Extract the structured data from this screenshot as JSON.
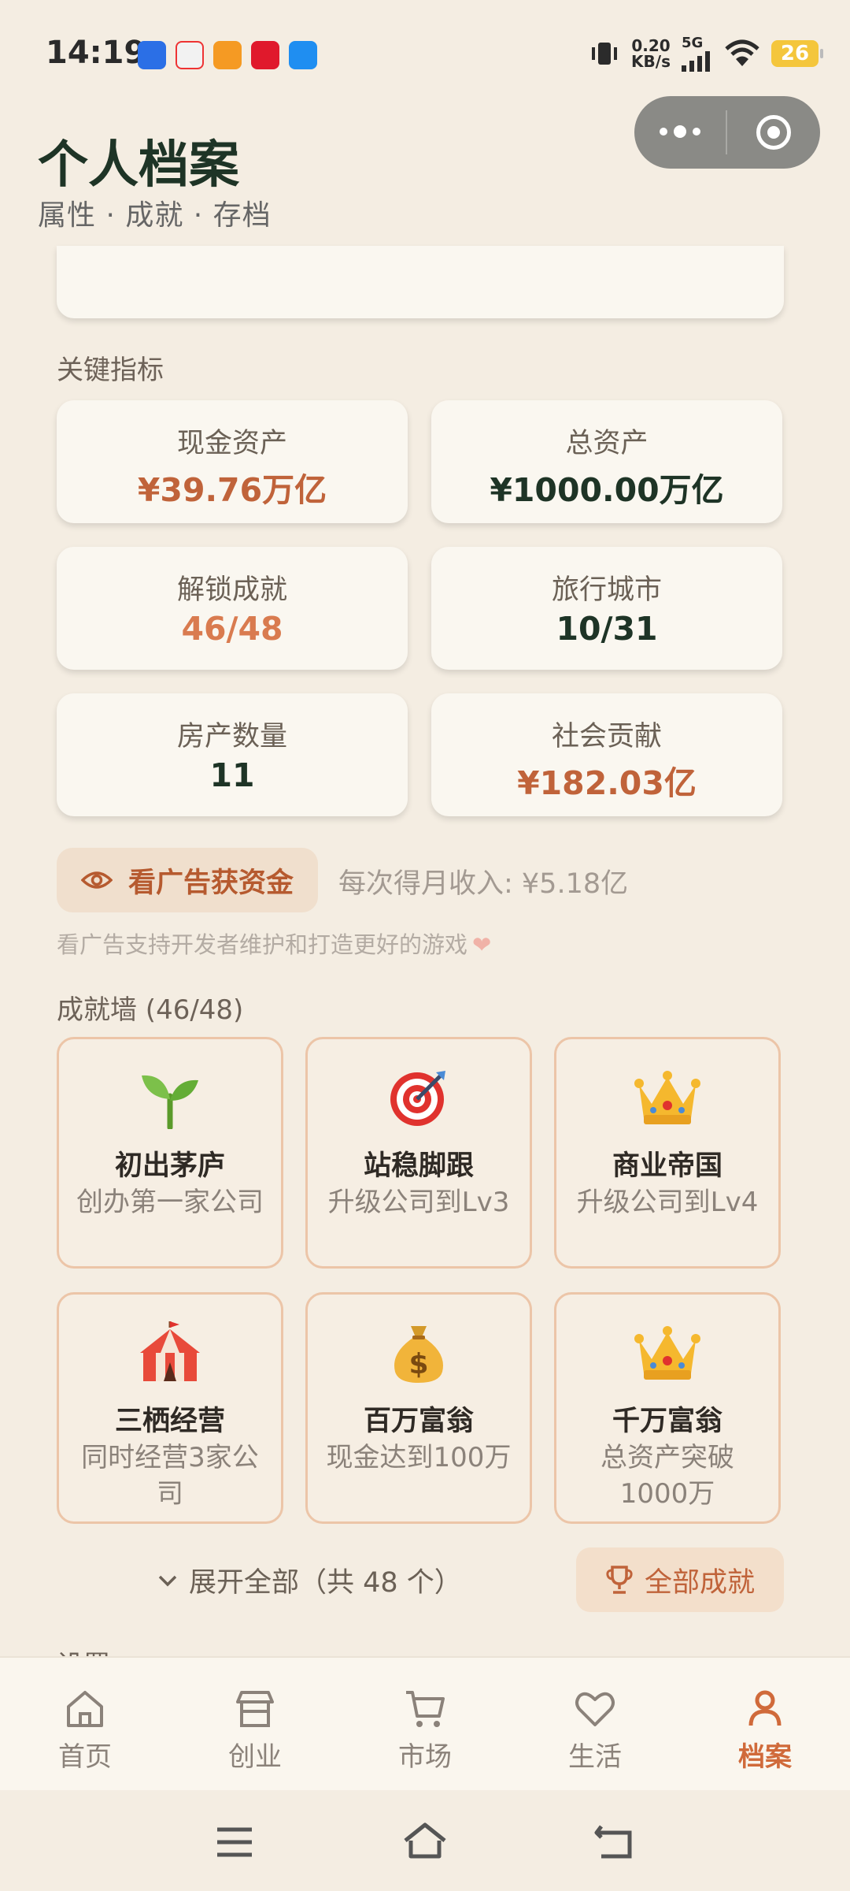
{
  "status_bar": {
    "time": "14:19",
    "speed_value": "0.20",
    "speed_unit": "KB/s",
    "network": "5G",
    "battery": "26"
  },
  "header": {
    "title": "个人档案",
    "subtitle": "属性 · 成就 · 存档"
  },
  "metrics": {
    "section_label": "关键指标",
    "items": [
      {
        "label": "现金资产",
        "value": "¥39.76万亿",
        "color": "#c0633a"
      },
      {
        "label": "总资产",
        "value": "¥1000.00万亿",
        "color": "#1e3426"
      },
      {
        "label": "解锁成就",
        "value": "46/48",
        "color": "#d97b4f"
      },
      {
        "label": "旅行城市",
        "value": "10/31",
        "color": "#1e3426"
      },
      {
        "label": "房产数量",
        "value": "11",
        "color": "#1e3426"
      },
      {
        "label": "社会贡献",
        "value": "¥182.03亿",
        "color": "#c0633a"
      }
    ]
  },
  "ad": {
    "button_label": "看广告获资金",
    "income_text": "每次得月收入: ¥5.18亿",
    "note": "看广告支持开发者维护和打造更好的游戏"
  },
  "achievements": {
    "section_label": "成就墙 (46/48)",
    "items": [
      {
        "icon": "seedling-icon",
        "name": "初出茅庐",
        "desc": "创办第一家公司"
      },
      {
        "icon": "target-icon",
        "name": "站稳脚跟",
        "desc": "升级公司到Lv3"
      },
      {
        "icon": "crown-icon",
        "name": "商业帝国",
        "desc": "升级公司到Lv4"
      },
      {
        "icon": "circus-tent-icon",
        "name": "三栖经营",
        "desc": "同时经营3家公司"
      },
      {
        "icon": "money-bag-icon",
        "name": "百万富翁",
        "desc": "现金达到100万"
      },
      {
        "icon": "crown-icon",
        "name": "千万富翁",
        "desc": "总资产突破1000万"
      }
    ],
    "expand_label": "展开全部（共 48 个）",
    "all_button_label": "全部成就"
  },
  "settings_label": "设置",
  "tabs": [
    {
      "label": "首页",
      "icon": "home-icon",
      "active": false
    },
    {
      "label": "创业",
      "icon": "store-icon",
      "active": false
    },
    {
      "label": "市场",
      "icon": "cart-icon",
      "active": false
    },
    {
      "label": "生活",
      "icon": "heart-icon",
      "active": false
    },
    {
      "label": "档案",
      "icon": "profile-icon",
      "active": true
    }
  ],
  "colors": {
    "accent": "#d06a3a",
    "background": "#f4ede2",
    "card": "#faf7f0",
    "title": "#1e3426"
  }
}
